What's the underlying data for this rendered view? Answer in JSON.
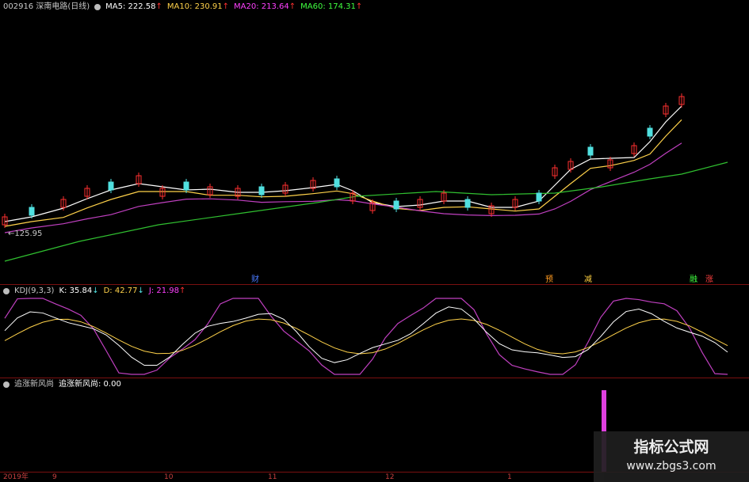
{
  "header": {
    "stock_title": "002916 深南电路(日线)",
    "ma5": {
      "label": "MA5: 222.58",
      "arrow": "↑",
      "color": "#ffffff"
    },
    "ma10": {
      "label": "MA10: 230.91",
      "arrow": "↑",
      "color": "#ffd24a"
    },
    "ma20": {
      "label": "MA20: 213.64",
      "arrow": "↑",
      "color": "#ff40ff"
    },
    "ma60": {
      "label": "MA60: 174.31",
      "arrow": "↑",
      "color": "#40ff40"
    }
  },
  "price_chart": {
    "low_label": "125.95",
    "event_markers": [
      {
        "text": "财",
        "color": "#4a7aff"
      },
      {
        "text": "预",
        "color": "#ff9a20"
      },
      {
        "text": "减",
        "color": "#ffd040"
      },
      {
        "text": "融",
        "color": "#40ff40"
      },
      {
        "text": "涨",
        "color": "#ff4040"
      }
    ]
  },
  "kdj_panel": {
    "name": "KDJ(9,3,3)",
    "k": "K: 35.84",
    "k_arrow": "↓",
    "d": "D: 42.77",
    "d_arrow": "↓",
    "j": "J: 21.98",
    "j_arrow": "↑"
  },
  "indicator_panel": {
    "name": "追涨新风尚",
    "value_label": "追涨新风尚: 0.00"
  },
  "x_axis": {
    "labels": [
      "2019年",
      "9",
      "10",
      "11",
      "12",
      "1"
    ]
  },
  "watermark": {
    "line1": "指标公式网",
    "line2": "www.zbgs3.com"
  },
  "colors": {
    "up": "#ff3030",
    "down": "#50e0e0",
    "ma5": "#ffffff",
    "ma10": "#ffd24a",
    "ma20": "#c040c0",
    "ma60": "#30c030",
    "j": "#c040c0",
    "separator": "#7a1010"
  }
}
